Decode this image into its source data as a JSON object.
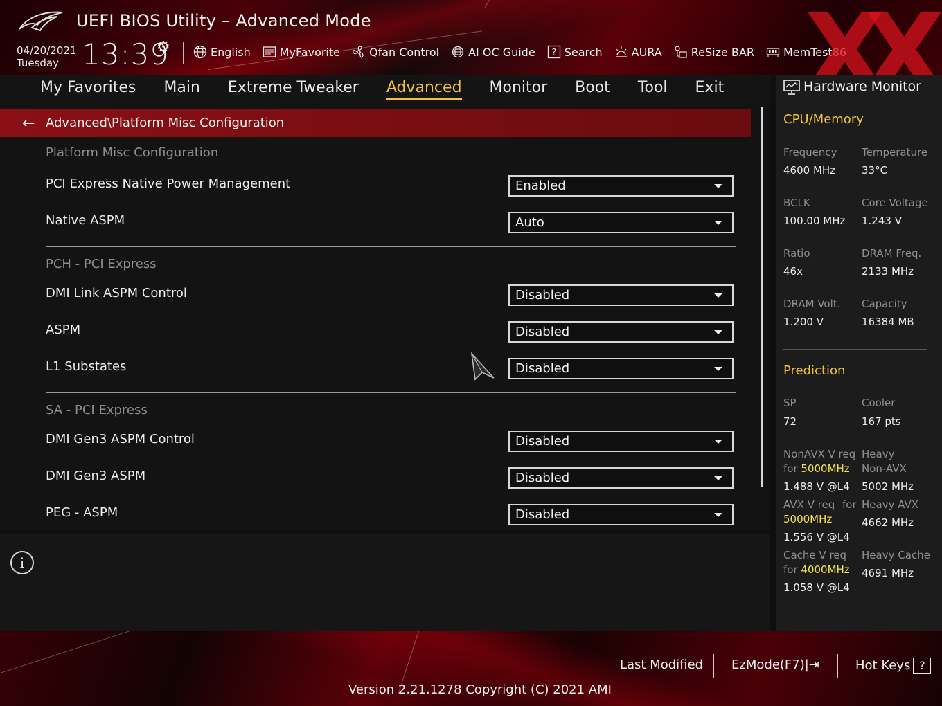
{
  "header": {
    "title": "UEFI BIOS Utility – Advanced Mode",
    "date": "04/20/2021",
    "day": "Tuesday",
    "time": "13:39",
    "toolbar": [
      {
        "label": "English",
        "icon": "globe-icon"
      },
      {
        "label": "MyFavorite",
        "icon": "favorite-list-icon"
      },
      {
        "label": "Qfan Control",
        "icon": "fan-icon"
      },
      {
        "label": "AI OC Guide",
        "icon": "ai-chip-icon"
      },
      {
        "label": "Search",
        "icon": "help-question-icon"
      },
      {
        "label": "AURA",
        "icon": "aura-light-icon"
      },
      {
        "label": "ReSize BAR",
        "icon": "resize-bar-icon"
      },
      {
        "label": "MemTest86",
        "icon": "memory-icon"
      }
    ]
  },
  "tabs": [
    {
      "label": "My Favorites",
      "active": false
    },
    {
      "label": "Main",
      "active": false
    },
    {
      "label": "Extreme Tweaker",
      "active": false
    },
    {
      "label": "Advanced",
      "active": true
    },
    {
      "label": "Monitor",
      "active": false
    },
    {
      "label": "Boot",
      "active": false
    },
    {
      "label": "Tool",
      "active": false
    },
    {
      "label": "Exit",
      "active": false
    }
  ],
  "breadcrumb": "Advanced\\Platform Misc Configuration",
  "sections": [
    {
      "title": "Platform Misc Configuration",
      "rows": [
        {
          "label": "PCI Express Native Power Management",
          "value": "Enabled"
        },
        {
          "label": "Native ASPM",
          "value": "Auto"
        }
      ]
    },
    {
      "title": "PCH - PCI Express",
      "rows": [
        {
          "label": "DMI Link ASPM Control",
          "value": "Disabled"
        },
        {
          "label": "ASPM",
          "value": "Disabled"
        },
        {
          "label": "L1 Substates",
          "value": "Disabled"
        }
      ]
    },
    {
      "title": "SA - PCI Express",
      "rows": [
        {
          "label": "DMI Gen3 ASPM Control",
          "value": "Disabled"
        },
        {
          "label": "DMI Gen3 ASPM",
          "value": "Disabled"
        },
        {
          "label": "PEG - ASPM",
          "value": "Disabled"
        }
      ]
    }
  ],
  "hardware_monitor": {
    "title": "Hardware Monitor",
    "cpu_memory": {
      "heading": "CPU/Memory",
      "items": [
        {
          "label": "Frequency",
          "value": "4600 MHz"
        },
        {
          "label": "Temperature",
          "value": "33°C"
        },
        {
          "label": "BCLK",
          "value": "100.00 MHz"
        },
        {
          "label": "Core Voltage",
          "value": "1.243 V"
        },
        {
          "label": "Ratio",
          "value": "46x"
        },
        {
          "label": "DRAM Freq.",
          "value": "2133 MHz"
        },
        {
          "label": "DRAM Volt.",
          "value": "1.200 V"
        },
        {
          "label": "Capacity",
          "value": "16384 MB"
        }
      ]
    },
    "prediction": {
      "heading": "Prediction",
      "sp_label": "SP",
      "sp_value": "72",
      "cooler_label": "Cooler",
      "cooler_value": "167 pts",
      "nonavx_req_a": "NonAVX V req",
      "nonavx_req_b": "for ",
      "nonavx_freq": "5000MHz",
      "nonavx_volt": "1.488 V @L4",
      "heavy_nonavx_a": "Heavy",
      "heavy_nonavx_b": "Non-AVX",
      "heavy_nonavx_value": "5002 MHz",
      "avx_req_a": "AVX V req",
      "avx_req_b": "for",
      "avx_freq": "5000MHz",
      "avx_volt": "1.556 V @L4",
      "heavy_avx_label": "Heavy AVX",
      "heavy_avx_value": "4662 MHz",
      "cache_req_a": "Cache V req",
      "cache_req_b": "for ",
      "cache_freq": "4000MHz",
      "cache_volt": "1.058 V @L4",
      "heavy_cache_label": "Heavy Cache",
      "heavy_cache_value": "4691 MHz",
      "highlight_color": "#f5e14a"
    }
  },
  "footer": {
    "last_modified": "Last Modified",
    "ezmode": "EzMode(F7)|",
    "hotkeys": "Hot Keys",
    "hotkeys_box": "?",
    "version": "Version 2.21.1278 Copyright (C) 2021 AMI"
  },
  "colors": {
    "accent": "#f5c33b",
    "breadcrumb_bg": "#8a1015",
    "brand_red": "#d7121c"
  }
}
